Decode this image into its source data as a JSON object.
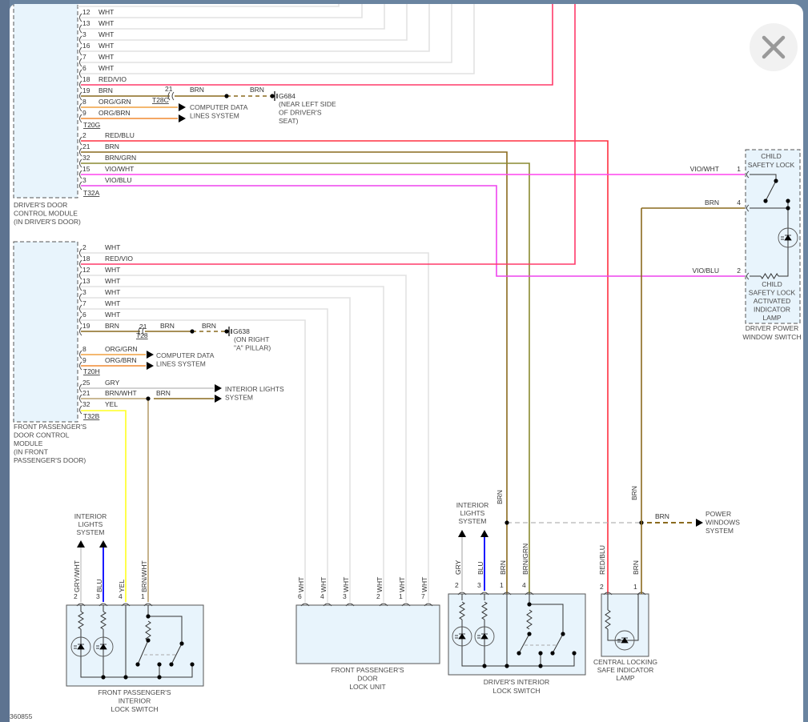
{
  "close_button": {
    "icon": "close-icon"
  },
  "figure_id": "360855",
  "wire_colors": {
    "WHT": "#e2e2e2",
    "RED/VIO": "#ff3a6a",
    "BRN": "#8a6a1e",
    "ORG/GRN": "#f0a040",
    "ORG/BRN": "#f08a30",
    "RED/BLU": "#ff3040",
    "BRN/GRN": "#8a8a30",
    "VIO/WHT": "#ff44ee",
    "VIO/BLU": "#ee44ee",
    "GRY": "#c4c4c4",
    "BRN/WHT": "#b8a070",
    "YEL": "#ffff20",
    "BLU": "#1a1aff",
    "GRY/WHT": "#cfcfcf"
  },
  "driver_module": {
    "label_lines": [
      "DRIVER'S DOOR",
      "CONTROL MODULE",
      "(IN DRIVER'S DOOR)"
    ],
    "wires_a": [
      {
        "pin": "12",
        "color": "WHT"
      },
      {
        "pin": "13",
        "color": "WHT"
      },
      {
        "pin": "3",
        "color": "WHT"
      },
      {
        "pin": "16",
        "color": "WHT"
      },
      {
        "pin": "7",
        "color": "WHT"
      },
      {
        "pin": "6",
        "color": "WHT"
      },
      {
        "pin": "18",
        "color": "RED/VIO"
      },
      {
        "pin": "19",
        "color": "BRN"
      },
      {
        "pin": "8",
        "color": "ORG/GRN"
      },
      {
        "pin": "9",
        "color": "ORG/BRN"
      }
    ],
    "connector_a": "T20G",
    "wires_b": [
      {
        "pin": "2",
        "color": "RED/BLU"
      },
      {
        "pin": "21",
        "color": "BRN"
      },
      {
        "pin": "32",
        "color": "BRN/GRN"
      },
      {
        "pin": "15",
        "color": "VIO/WHT"
      },
      {
        "pin": "3",
        "color": "VIO/BLU"
      }
    ],
    "connector_b": "T32A",
    "ground": {
      "pin": "21",
      "connector": "T28C",
      "wire1": "BRN",
      "wire2": "BRN",
      "id": "G684",
      "location_lines": [
        "(NEAR LEFT SIDE",
        "OF DRIVER'S",
        "SEAT)"
      ]
    },
    "data_lines_label": [
      "COMPUTER DATA",
      "LINES SYSTEM"
    ]
  },
  "passenger_module": {
    "label_lines": [
      "FRONT PASSENGER'S",
      "DOOR CONTROL",
      "MODULE",
      "(IN FRONT",
      "PASSENGER'S DOOR)"
    ],
    "wires_a": [
      {
        "pin": "2",
        "color": "WHT"
      },
      {
        "pin": "18",
        "color": "RED/VIO"
      },
      {
        "pin": "12",
        "color": "WHT"
      },
      {
        "pin": "13",
        "color": "WHT"
      },
      {
        "pin": "3",
        "color": "WHT"
      },
      {
        "pin": "7",
        "color": "WHT"
      },
      {
        "pin": "6",
        "color": "WHT"
      },
      {
        "pin": "19",
        "color": "BRN"
      }
    ],
    "wires_data": [
      {
        "pin": "8",
        "color": "ORG/GRN"
      },
      {
        "pin": "9",
        "color": "ORG/BRN"
      }
    ],
    "connector_a": "T20H",
    "wires_b": [
      {
        "pin": "25",
        "color": "GRY"
      },
      {
        "pin": "21",
        "color": "BRN/WHT"
      },
      {
        "pin": "32",
        "color": "YEL"
      }
    ],
    "connector_b": "T32B",
    "ground": {
      "pin": "21",
      "connector": "T28",
      "wire1": "BRN",
      "wire2": "BRN",
      "id": "G638",
      "location_lines": [
        "(ON RIGHT",
        "\"A\" PILLAR)"
      ]
    },
    "data_lines_label": [
      "COMPUTER DATA",
      "LINES SYSTEM"
    ],
    "interior_lights_label": [
      "INTERIOR LIGHTS",
      "SYSTEM"
    ],
    "splice_wire": "BRN"
  },
  "pass_lock_switch": {
    "pins": [
      {
        "pin": "2",
        "wire": "GRY/WHT"
      },
      {
        "pin": "3",
        "wire": "BLU"
      },
      {
        "pin": "4",
        "wire": "YEL"
      },
      {
        "pin": "1",
        "wire": "BRN/WHT"
      }
    ],
    "interior_lights_label": [
      "INTERIOR",
      "LIGHTS",
      "SYSTEM"
    ],
    "label_lines": [
      "FRONT PASSENGER'S",
      "INTERIOR",
      "LOCK SWITCH"
    ]
  },
  "door_lock_unit": {
    "pins": [
      {
        "pin": "6",
        "wire": "WHT"
      },
      {
        "pin": "4",
        "wire": "WHT"
      },
      {
        "pin": "3",
        "wire": "WHT"
      },
      {
        "pin": "2",
        "wire": "WHT"
      },
      {
        "pin": "1",
        "wire": "WHT"
      },
      {
        "pin": "7",
        "wire": "WHT"
      }
    ],
    "label_lines": [
      "FRONT PASSENGER'S",
      "DOOR",
      "LOCK UNIT"
    ]
  },
  "driver_lock_switch": {
    "pins": [
      {
        "pin": "2",
        "wire": "GRY"
      },
      {
        "pin": "3",
        "wire": "BLU"
      },
      {
        "pin": "1",
        "wire": "BRN"
      },
      {
        "pin": "4",
        "wire": "BRN/GRN"
      }
    ],
    "upper_wire": "BRN",
    "interior_lights_label": [
      "INTERIOR",
      "LIGHTS",
      "SYSTEM"
    ],
    "label_lines": [
      "DRIVER'S INTERIOR",
      "LOCK SWITCH"
    ]
  },
  "central_lamp": {
    "pins": [
      {
        "pin": "2",
        "wire": "RED/BLU"
      },
      {
        "pin": "1",
        "wire": "BRN"
      }
    ],
    "upper_wire": "BRN",
    "label_lines": [
      "CENTRAL LOCKING",
      "SAFE INDICATOR",
      "LAMP"
    ]
  },
  "power_windows": {
    "wire": "BRN",
    "label_lines": [
      "POWER",
      "WINDOWS",
      "SYSTEM"
    ]
  },
  "power_window_switch": {
    "pins": [
      {
        "pin": "1",
        "wire": "VIO/WHT"
      },
      {
        "pin": "4",
        "wire": "BRN"
      },
      {
        "pin": "2",
        "wire": "VIO/BLU"
      }
    ],
    "child_lock_lines": [
      "CHILD",
      "SAFETY LOCK"
    ],
    "indicator_lines": [
      "CHILD",
      "SAFETY LOCK",
      "ACTIVATED",
      "INDICATOR",
      "LAMP"
    ],
    "label_lines": [
      "DRIVER POWER",
      "WINDOW SWITCH"
    ]
  }
}
